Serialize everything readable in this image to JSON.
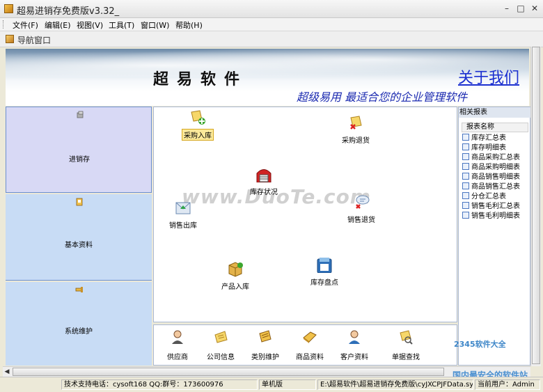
{
  "window": {
    "title": "超易进销存免费版v3.32_",
    "min": "–",
    "max": "□",
    "close": "✕"
  },
  "menu": {
    "items": [
      "文件(F)",
      "编辑(E)",
      "视图(V)",
      "工具(T)",
      "窗口(W)",
      "帮助(H)"
    ]
  },
  "nav_window": {
    "title": "导航窗口"
  },
  "banner": {
    "brand": "超易软件",
    "about": "关于我们",
    "slogan": "超级易用  最适合您的企业管理软件"
  },
  "sidebar": {
    "sections": [
      {
        "label": "进销存",
        "icon": "package-icon",
        "color": "#d8d9f5",
        "active": true
      },
      {
        "label": "基本资料",
        "icon": "book-icon",
        "color": "#c8dcf5"
      },
      {
        "label": "系统维护",
        "icon": "tool-icon",
        "color": "#c8dcf5"
      }
    ]
  },
  "flow": {
    "purchase_in": "采购入库",
    "purchase_return": "采购退货",
    "stock_status": "库存状况",
    "sales_out": "销售出库",
    "sales_return": "销售退货",
    "product_in": "产品入库",
    "stock_count": "库存盘点"
  },
  "watermark": "www.DuoTe.com",
  "toolbar": {
    "items": [
      "供应商",
      "公司信息",
      "类别维护",
      "商品资料",
      "客户资料",
      "单据查找"
    ]
  },
  "reports": {
    "title": "相关报表",
    "header": "报表名称",
    "items": [
      "库存汇总表",
      "库存明细表",
      "商品采购汇总表",
      "商品采购明细表",
      "商品销售明细表",
      "商品销售汇总表",
      "分仓汇总表",
      "销售毛利汇总表",
      "销售毛利明细表"
    ]
  },
  "statusbar": {
    "support": "技术支持电话：cysoft168 QQ:群号：173600976",
    "edition": "单机版",
    "path": "E:\\超易软件\\超易进销存免费版\\cyJXCPJFData.sys",
    "user": "当前用户：Admin"
  },
  "corner": {
    "logo": "2345软件大全",
    "tagline": "国内最安全的软件站"
  },
  "colors": {
    "link": "#1b2fd0",
    "slogan": "#1b2ab0",
    "sidebar_active": "#d8d9f5",
    "sidebar": "#c8dcf5"
  }
}
